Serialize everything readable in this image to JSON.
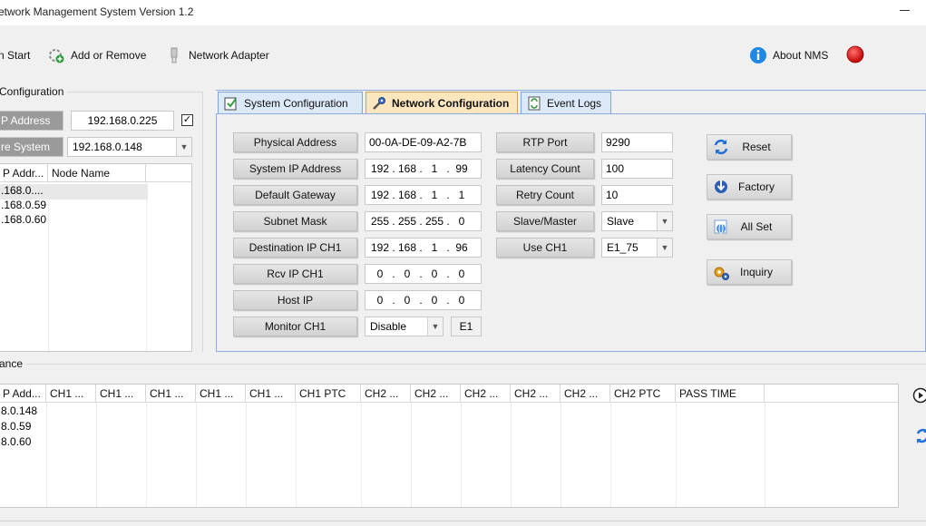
{
  "window": {
    "title": "etwork Management System Version 1.2"
  },
  "toolbar": {
    "start_label": "n Start",
    "add_remove_label": "Add or Remove",
    "network_adapter_label": "Network Adapter",
    "about_label": "About NMS"
  },
  "left_panel": {
    "group_label": "Configuration",
    "ip_address_btn": "P Address",
    "ip_address_value": "192.168.0.225",
    "ip_checked": "✓",
    "system_btn": "re System",
    "system_value": "192.168.0.148",
    "node_columns": [
      "P Addr...",
      "Node Name"
    ],
    "node_rows": [
      {
        "ip": ".168.0....",
        "name": ""
      },
      {
        "ip": ".168.0.59",
        "name": ""
      },
      {
        "ip": ".168.0.60",
        "name": ""
      }
    ]
  },
  "tabs": [
    {
      "label": "System Configuration",
      "icon": "checklist-icon"
    },
    {
      "label": "Network Configuration",
      "icon": "network-wrench-icon"
    },
    {
      "label": "Event Logs",
      "icon": "refresh-log-icon"
    }
  ],
  "network_config": {
    "physical_address": {
      "label": "Physical Address",
      "value": "00-0A-DE-09-A2-7B"
    },
    "system_ip": {
      "label": "System IP Address",
      "octets": [
        "192",
        "168",
        "1",
        "99"
      ]
    },
    "default_gateway": {
      "label": "Default Gateway",
      "octets": [
        "192",
        "168",
        "1",
        "1"
      ]
    },
    "subnet_mask": {
      "label": "Subnet Mask",
      "octets": [
        "255",
        "255",
        "255",
        "0"
      ]
    },
    "destination_ip": {
      "label": "Destination IP CH1",
      "octets": [
        "192",
        "168",
        "1",
        "96"
      ]
    },
    "rcv_ip": {
      "label": "Rcv IP CH1",
      "octets": [
        "0",
        "0",
        "0",
        "0"
      ]
    },
    "host_ip": {
      "label": "Host IP",
      "octets": [
        "0",
        "0",
        "0",
        "0"
      ]
    },
    "monitor": {
      "label": "Monitor CH1",
      "value": "Disable",
      "badge": "E1"
    },
    "rtp_port": {
      "label": "RTP Port",
      "value": "9290"
    },
    "latency_count": {
      "label": "Latency Count",
      "value": "100"
    },
    "retry_count": {
      "label": "Retry Count",
      "value": "10"
    },
    "slave_master": {
      "label": "Slave/Master",
      "value": "Slave"
    },
    "use_ch": {
      "label": "Use CH1",
      "value": "E1_75"
    }
  },
  "actions": {
    "reset": "Reset",
    "factory": "Factory",
    "all_set": "All Set",
    "inquiry": "Inquiry"
  },
  "performance": {
    "group_label": "ance",
    "columns": [
      "P Add...",
      "CH1 ...",
      "CH1 ...",
      "CH1 ...",
      "CH1 ...",
      "CH1 ...",
      "CH1 PTC",
      "CH2 ...",
      "CH2 ...",
      "CH2 ...",
      "CH2 ...",
      "CH2 ...",
      "CH2 PTC",
      "PASS TIME"
    ],
    "rows": [
      "8.0.148",
      "8.0.59",
      "8.0.60"
    ]
  },
  "colors": {
    "tab_active": "#fbe6bd",
    "tab_inactive": "#dce9f9",
    "stop_red": "#e02020",
    "info_blue": "#1e88e5"
  }
}
